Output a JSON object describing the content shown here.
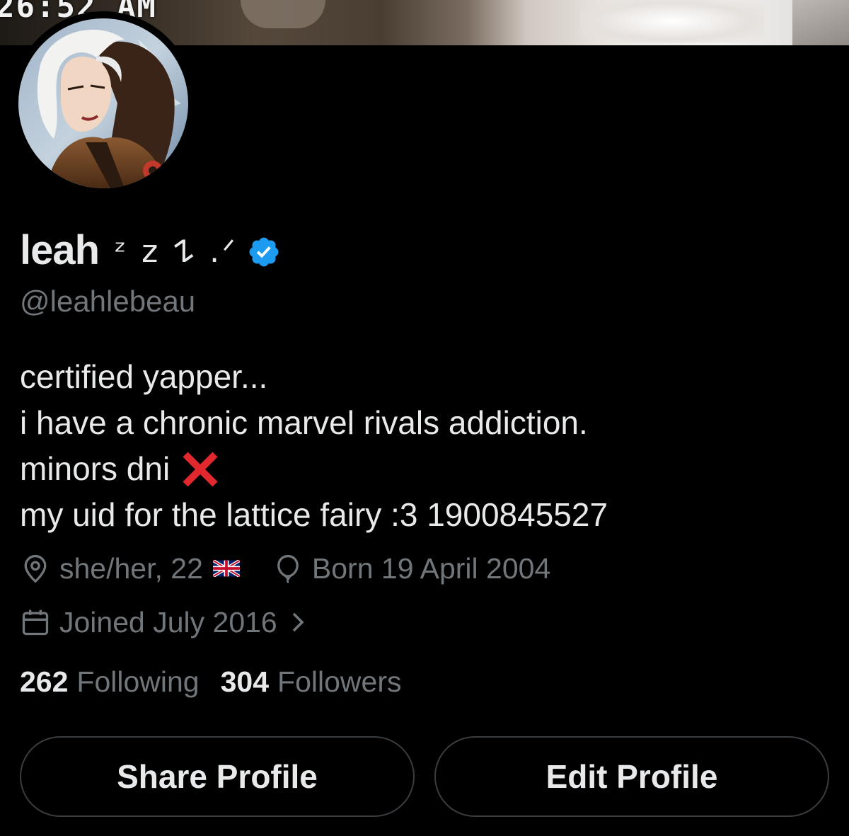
{
  "banner": {
    "time_text": "26:52 AM"
  },
  "profile": {
    "name": "leah",
    "name_decoration": "ᶻ z 𐰁 .ᐟ",
    "verified": true,
    "handle": "@leahlebeau",
    "bio_lines": [
      "certified yapper...",
      "i have a chronic marvel rivals addiction.",
      "minors dni",
      "my uid for the lattice fairy :3 1900845527"
    ],
    "bio_emoji": "x-mark-icon",
    "location": "she/her, 22",
    "location_flag": "uk-flag-icon",
    "birthday": "Born 19 April 2004",
    "joined": "Joined July 2016"
  },
  "stats": {
    "following_count": "262",
    "following_label": "Following",
    "followers_count": "304",
    "followers_label": "Followers"
  },
  "buttons": {
    "share_label": "Share Profile",
    "edit_label": "Edit Profile"
  },
  "colors": {
    "background": "#000000",
    "text_primary": "#e7e9ea",
    "text_secondary": "#71767b",
    "verified_blue": "#1d9bf0",
    "button_border": "#3a3d40"
  }
}
